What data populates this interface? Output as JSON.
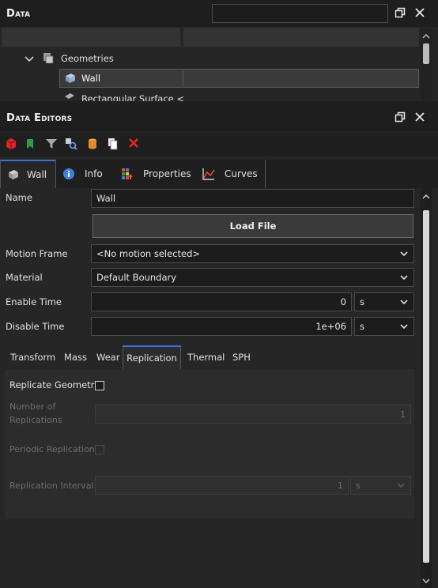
{
  "data_panel": {
    "title": "Data",
    "tree": {
      "geometries_label": "Geometries",
      "wall_label": "Wall",
      "rect_label": "Rectangular Surface <"
    }
  },
  "editors_panel": {
    "title": "Data Editors",
    "tabs": [
      {
        "label": "Wall"
      },
      {
        "label": "Info"
      },
      {
        "label": "Properties"
      },
      {
        "label": "Curves"
      }
    ],
    "form": {
      "name_label": "Name",
      "name_value": "Wall",
      "load_file_label": "Load File",
      "motion_frame_label": "Motion Frame",
      "motion_frame_value": "<No motion selected>",
      "material_label": "Material",
      "material_value": "Default Boundary",
      "enable_time_label": "Enable Time",
      "enable_time_value": "0",
      "enable_time_unit": "s",
      "disable_time_label": "Disable Time",
      "disable_time_value": "1e+06",
      "disable_time_unit": "s"
    },
    "subtabs": [
      {
        "label": "Transform"
      },
      {
        "label": "Mass"
      },
      {
        "label": "Wear"
      },
      {
        "label": "Replication"
      },
      {
        "label": "Thermal"
      },
      {
        "label": "SPH"
      }
    ],
    "replication": {
      "replicate_geometry_label": "Replicate Geometry",
      "number_of_label_1": "Number of",
      "number_of_label_2": "Replications",
      "number_of_value": "1",
      "periodic_label": "Periodic Replication",
      "interval_label": "Replication Interval:",
      "interval_value": "1",
      "interval_unit": "s"
    }
  },
  "colors": {
    "accent": "#3c6fd8",
    "background": "#1f1f1f",
    "header": "#1e1e1e"
  }
}
